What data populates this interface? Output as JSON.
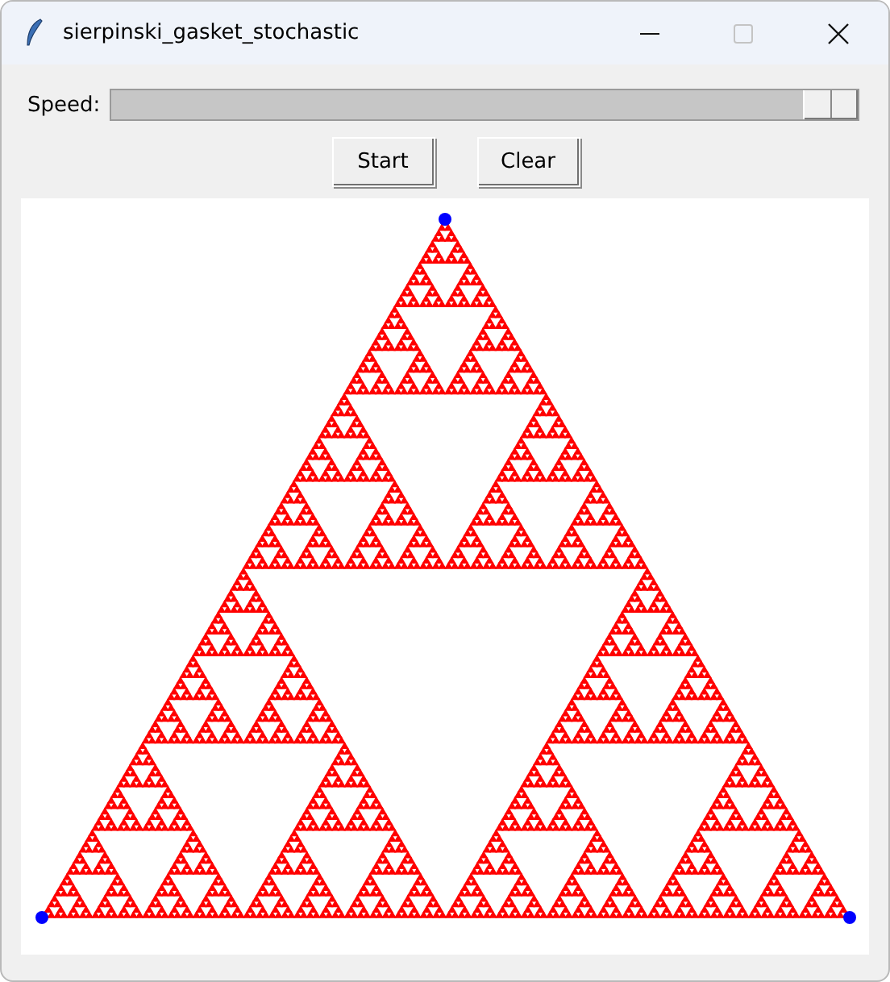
{
  "window": {
    "title": "sierpinski_gasket_stochastic"
  },
  "speed": {
    "label": "Speed:",
    "level": 1
  },
  "buttons": [
    {
      "label": "Start"
    },
    {
      "label": "Clear"
    }
  ]
}
